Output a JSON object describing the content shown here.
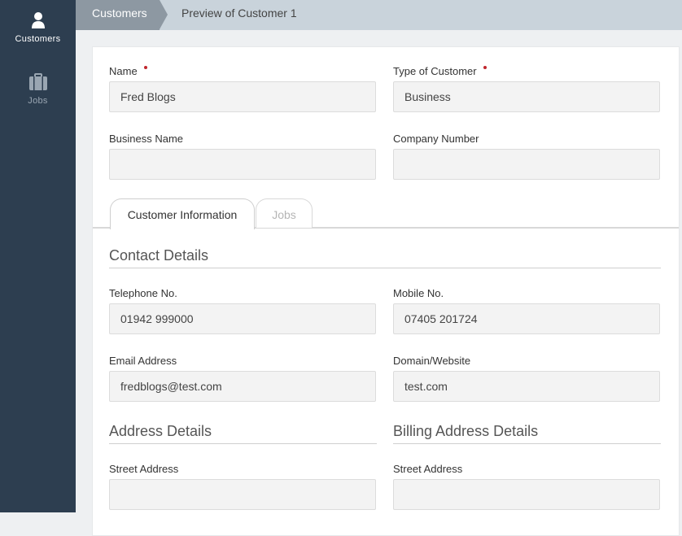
{
  "sidebar": {
    "items": [
      {
        "label": "Customers",
        "icon": "user-icon",
        "active": true
      },
      {
        "label": "Jobs",
        "icon": "briefcase-icon",
        "active": false
      }
    ]
  },
  "breadcrumb": {
    "root": "Customers",
    "current": "Preview of Customer 1"
  },
  "form": {
    "name": {
      "label": "Name",
      "value": "Fred Blogs",
      "required": true
    },
    "type_of_customer": {
      "label": "Type of Customer",
      "value": "Business",
      "required": true
    },
    "business_name": {
      "label": "Business Name",
      "value": ""
    },
    "company_number": {
      "label": "Company Number",
      "value": ""
    }
  },
  "tabs": [
    {
      "label": "Customer Information",
      "active": true
    },
    {
      "label": "Jobs",
      "active": false
    }
  ],
  "contact": {
    "title": "Contact Details",
    "telephone": {
      "label": "Telephone No.",
      "value": "01942 999000"
    },
    "mobile": {
      "label": "Mobile No.",
      "value": "07405 201724"
    },
    "email": {
      "label": "Email Address",
      "value": "fredblogs@test.com"
    },
    "website": {
      "label": "Domain/Website",
      "value": "test.com"
    }
  },
  "address": {
    "title": "Address Details",
    "street": {
      "label": "Street Address",
      "value": ""
    }
  },
  "billing": {
    "title": "Billing Address Details",
    "street": {
      "label": "Street Address",
      "value": ""
    }
  },
  "colors": {
    "sidebar": "#2d3e50",
    "required_dot": "#c0262d",
    "breadcrumb_bg": "#c9d3db"
  }
}
